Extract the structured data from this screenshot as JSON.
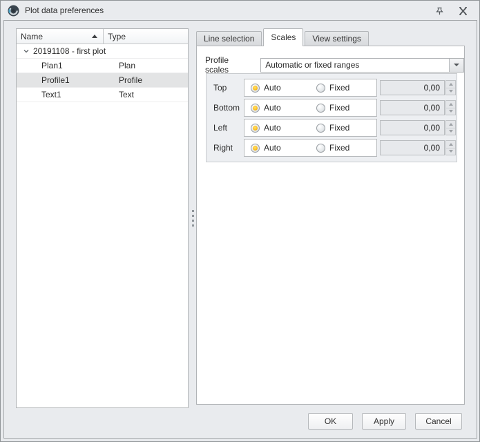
{
  "window": {
    "title": "Plot data preferences"
  },
  "icons": {
    "app": "aperture-logo",
    "pin": "pin",
    "close": "close-x",
    "sort": "triangle-up-ascending",
    "expand": "chevron-down-expanded",
    "combo_arrow": "triangle-down",
    "spin_up": "triangle-up",
    "spin_down": "triangle-down",
    "splitter": "drag-dots"
  },
  "colors": {
    "dialog_bg": "#e9ebee",
    "panel_bg": "#ffffff",
    "selected_row_bg": "#e3e4e5",
    "radio_selected_center": "#ffe06b",
    "radio_selected_ring": "#e39703",
    "disabled_field_bg": "#e7e9ec",
    "border": "#b1b4b7"
  },
  "tree": {
    "columns": [
      "Name",
      "Type"
    ],
    "sort_column": "Name",
    "sort_direction": "ascending",
    "rows": [
      {
        "name": "20191108 - first plot",
        "type": "",
        "level": 0,
        "expanded": true,
        "selected": false
      },
      {
        "name": "Plan1",
        "type": "Plan",
        "level": 1,
        "selected": false
      },
      {
        "name": "Profile1",
        "type": "Profile",
        "level": 1,
        "selected": true
      },
      {
        "name": "Text1",
        "type": "Text",
        "level": 1,
        "selected": false
      }
    ]
  },
  "tabs": [
    {
      "label": "Line selection",
      "active": false
    },
    {
      "label": "Scales",
      "active": true
    },
    {
      "label": "View settings",
      "active": false
    }
  ],
  "scales": {
    "profile_scales_label": "Profile scales",
    "profile_scales_value": "Automatic or fixed ranges",
    "rows": [
      {
        "label": "Top",
        "auto_label": "Auto",
        "fixed_label": "Fixed",
        "selected": "auto",
        "value": "0,00"
      },
      {
        "label": "Bottom",
        "auto_label": "Auto",
        "fixed_label": "Fixed",
        "selected": "auto",
        "value": "0,00"
      },
      {
        "label": "Left",
        "auto_label": "Auto",
        "fixed_label": "Fixed",
        "selected": "auto",
        "value": "0,00"
      },
      {
        "label": "Right",
        "auto_label": "Auto",
        "fixed_label": "Fixed",
        "selected": "auto",
        "value": "0,00"
      }
    ]
  },
  "footer": {
    "ok": "OK",
    "apply": "Apply",
    "cancel": "Cancel"
  }
}
